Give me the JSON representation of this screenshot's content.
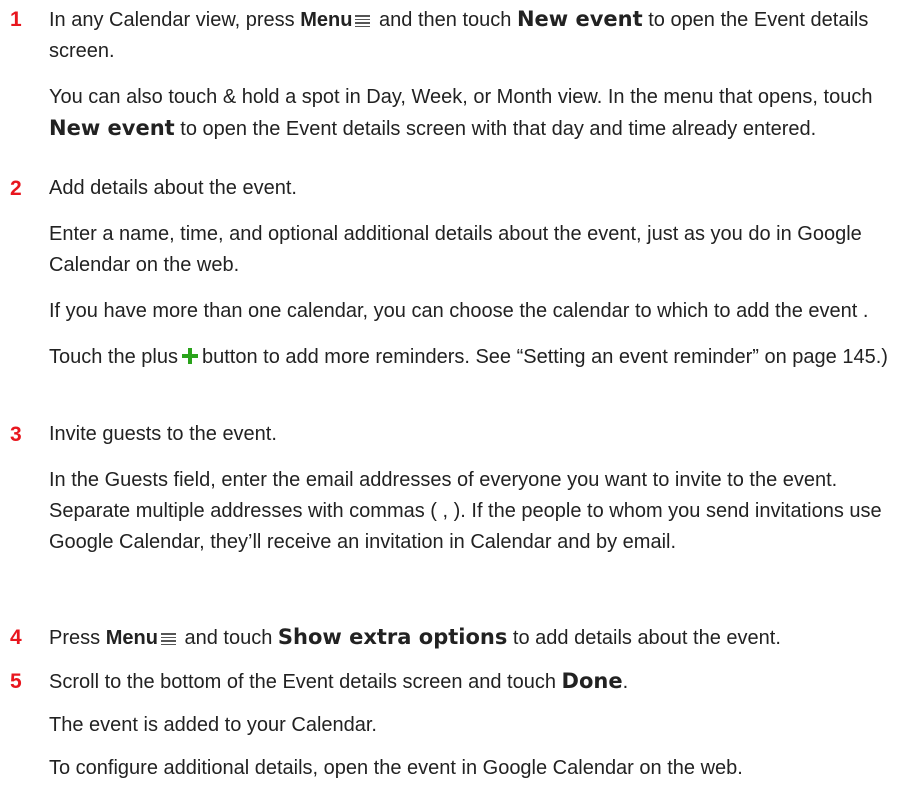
{
  "steps": [
    {
      "number": "1",
      "line1": {
        "a": "In any Calendar view, press",
        "menu": "Menu",
        "b": "and then touch",
        "new_event": "New event",
        "c": "to open the Event details screen."
      },
      "p2": {
        "a": "You can also touch & hold a spot in Day, Week, or Month view. In the menu that opens, touch",
        "new_event": "New event",
        "b": "to open the Event details screen with that day and time already entered."
      }
    },
    {
      "number": "2",
      "line1": "Add details about the event.",
      "p2": "Enter a name, time, and optional additional details about the event, just as you do in Google Calendar on the web.",
      "p3": "If you have more than one calendar, you can choose the calendar to which to add the event .",
      "p4": {
        "a": "Touch the plus",
        "b": "button to add more reminders. See “Setting an event reminder” on page 145.)"
      }
    },
    {
      "number": "3",
      "line1": "Invite guests to the event.",
      "p2": "In the Guests field, enter the email addresses of everyone you want to invite to the event. Separate multiple addresses with commas ( , ). If the people to whom you send invitations use Google Calendar, they’ll receive an invitation in Calendar and by email."
    },
    {
      "number": "4",
      "line1": {
        "a": "Press",
        "menu": "Menu",
        "b": "and touch",
        "show_extra": "Show extra options",
        "c": "to add details about the event."
      }
    },
    {
      "number": "5",
      "line1": {
        "a": "Scroll to the bottom of the Event details screen and touch",
        "done": "Done",
        "c": "."
      },
      "p2": "The event is added to your Calendar.",
      "p3": "To configure additional details, open the event in Google Calendar on the web."
    }
  ],
  "icons": {
    "menu": "menu-icon",
    "plus": "plus-icon",
    "plus_color": "#2aa31b",
    "number_color": "#e8161e"
  }
}
